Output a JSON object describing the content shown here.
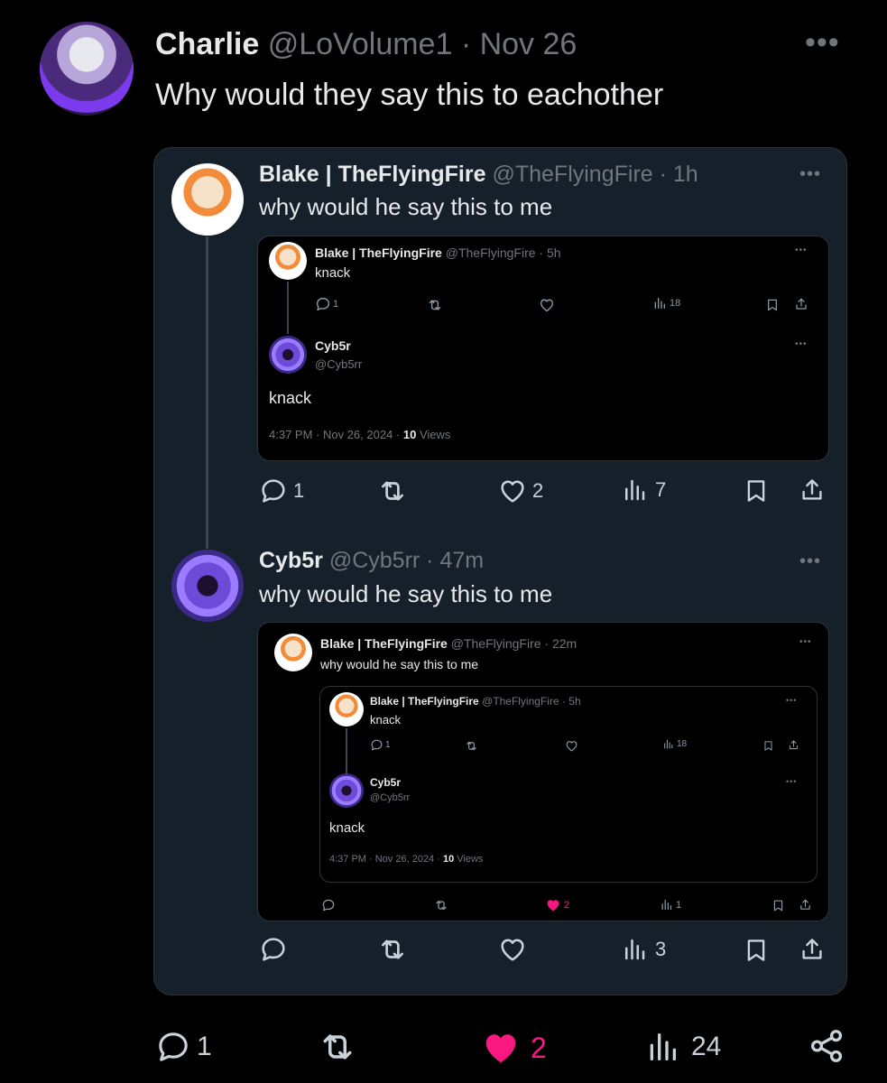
{
  "main_post": {
    "name": "Charlie",
    "handle": "@LoVolume1",
    "time": "Nov 26",
    "text": "Why would they say this to eachother",
    "stats": {
      "replies": "1",
      "likes": "2",
      "views": "24"
    }
  },
  "quote_card": {
    "posts": [
      {
        "name": "Blake | TheFlyingFire",
        "handle": "@TheFlyingFire",
        "time": "1h",
        "text": "why would he say this to me",
        "stats": {
          "replies": "1",
          "likes": "2",
          "views": "7"
        },
        "embed": {
          "top": {
            "name": "Blake | TheFlyingFire",
            "handle": "@TheFlyingFire",
            "time": "5h",
            "text": "knack",
            "replies": "1",
            "views": "18"
          },
          "reply": {
            "name": "Cyb5r",
            "handle": "@Cyb5rr",
            "text": "knack",
            "meta_time": "4:37 PM · Nov 26, 2024 · ",
            "views_count": "10",
            "views_label": " Views"
          }
        }
      },
      {
        "name": "Cyb5r",
        "handle": "@Cyb5rr",
        "time": "47m",
        "text": "why would he say this to me",
        "stats": {
          "views": "3"
        },
        "embed": {
          "name": "Blake | TheFlyingFire",
          "handle": "@TheFlyingFire",
          "time": "22m",
          "text": "why would he say this to me",
          "stats": {
            "likes": "2",
            "views": "1"
          },
          "inner": {
            "top": {
              "name": "Blake | TheFlyingFire",
              "handle": "@TheFlyingFire",
              "time": "5h",
              "text": "knack",
              "replies": "1",
              "views": "18"
            },
            "reply": {
              "name": "Cyb5r",
              "handle": "@Cyb5rr",
              "text": "knack",
              "meta_time": "4:37 PM · Nov 26, 2024 · ",
              "views_count": "10",
              "views_label": " Views"
            }
          }
        }
      }
    ]
  },
  "separator": " · ",
  "icons": [
    "more-icon",
    "reply-icon",
    "retweet-icon",
    "like-icon",
    "views-icon",
    "bookmark-icon",
    "share-icon",
    "share-network-icon"
  ],
  "colors": {
    "background": "#000000",
    "card": "#16202b",
    "like_active": "#f91880",
    "muted": "#71767b"
  }
}
